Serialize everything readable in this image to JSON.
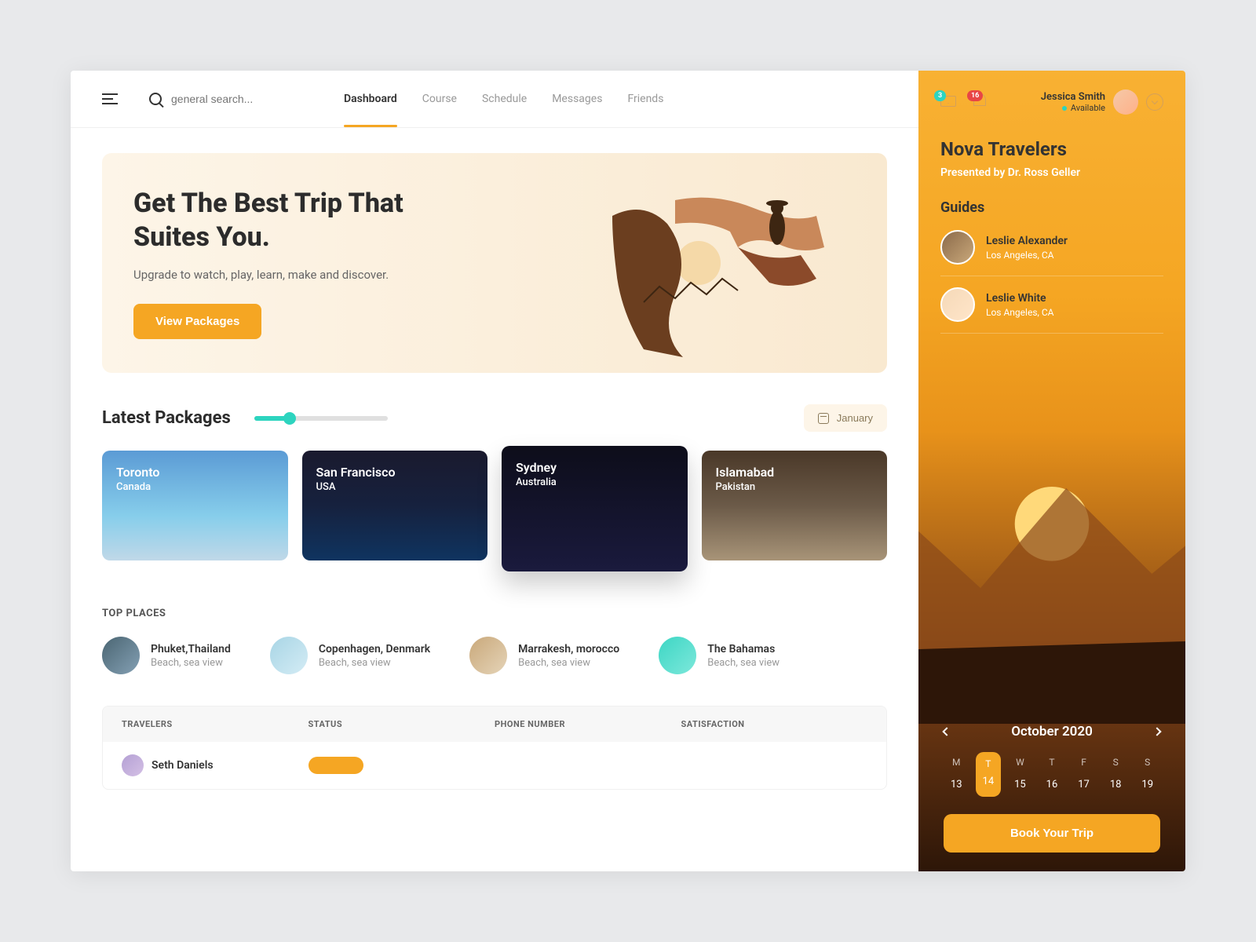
{
  "search": {
    "placeholder": "general search..."
  },
  "nav": [
    "Dashboard",
    "Course",
    "Schedule",
    "Messages",
    "Friends"
  ],
  "hero": {
    "title": "Get The Best Trip That Suites You.",
    "subtitle": "Upgrade to watch, play, learn, make and discover.",
    "cta": "View Packages"
  },
  "packages": {
    "title": "Latest Packages",
    "month_filter": "January",
    "items": [
      {
        "city": "Toronto",
        "country": "Canada"
      },
      {
        "city": "San Francisco",
        "country": "USA"
      },
      {
        "city": "Sydney",
        "country": "Australia"
      },
      {
        "city": "Islamabad",
        "country": "Pakistan"
      }
    ]
  },
  "top_places": {
    "title": "TOP PLACES",
    "items": [
      {
        "name": "Phuket,Thailand",
        "desc": "Beach, sea view"
      },
      {
        "name": "Copenhagen, Denmark",
        "desc": "Beach, sea view"
      },
      {
        "name": "Marrakesh, morocco",
        "desc": "Beach, sea view"
      },
      {
        "name": "The Bahamas",
        "desc": "Beach, sea view"
      }
    ]
  },
  "table": {
    "headers": [
      "TRAVELERS",
      "STATUS",
      "PHONE NUMBER",
      "SATISFACTION"
    ],
    "rows": [
      {
        "name": "Seth Daniels"
      }
    ]
  },
  "sidebar": {
    "notifications": {
      "mail": "3",
      "bell": "16"
    },
    "user": {
      "name": "Jessica Smith",
      "status": "Available"
    },
    "title": "Nova Travelers",
    "presenter": "Presented by Dr. Ross Geller",
    "guides_title": "Guides",
    "guides": [
      {
        "name": "Leslie Alexander",
        "location": "Los Angeles, CA"
      },
      {
        "name": "Leslie White",
        "location": "Los Angeles, CA"
      }
    ],
    "calendar": {
      "month": "October 2020",
      "days": [
        "M",
        "T",
        "W",
        "T",
        "F",
        "S",
        "S"
      ],
      "dates": [
        "13",
        "14",
        "15",
        "16",
        "17",
        "18",
        "19"
      ],
      "active_index": 1
    },
    "book_cta": "Book Your Trip"
  }
}
